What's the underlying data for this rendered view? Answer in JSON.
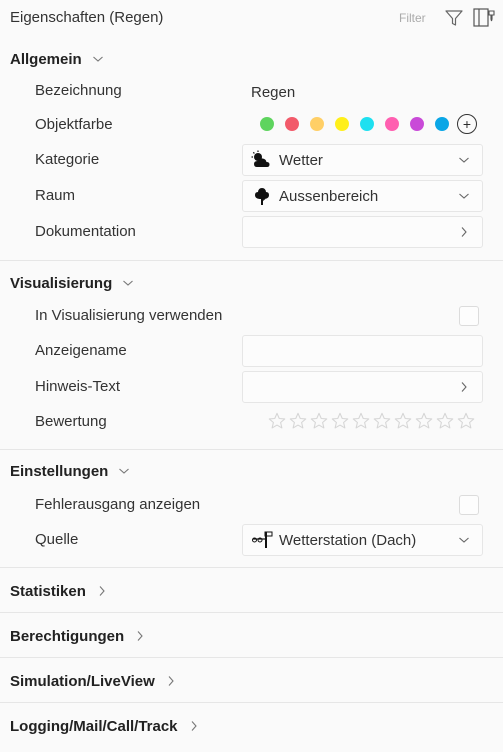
{
  "header": {
    "title": "Eigenschaften (Regen)",
    "filter_label": "Filter"
  },
  "sections": {
    "allgemein": {
      "title": "Allgemein",
      "rows": {
        "bezeichnung": {
          "label": "Bezeichnung",
          "value": "Regen"
        },
        "objektfarbe": {
          "label": "Objektfarbe"
        },
        "kategorie": {
          "label": "Kategorie",
          "value": "Wetter"
        },
        "raum": {
          "label": "Raum",
          "value": "Aussenbereich"
        },
        "dokumentation": {
          "label": "Dokumentation",
          "value": ""
        }
      }
    },
    "visualisierung": {
      "title": "Visualisierung",
      "rows": {
        "verwenden": {
          "label": "In Visualisierung verwenden",
          "checked": false
        },
        "anzeigename": {
          "label": "Anzeigename",
          "value": ""
        },
        "hinweis": {
          "label": "Hinweis-Text",
          "value": ""
        },
        "bewertung": {
          "label": "Bewertung",
          "stars_total": 10,
          "stars_filled": 0
        }
      }
    },
    "einstellungen": {
      "title": "Einstellungen",
      "rows": {
        "fehlerausgang": {
          "label": "Fehlerausgang anzeigen",
          "checked": false
        },
        "quelle": {
          "label": "Quelle",
          "value": "Wetterstation (Dach)"
        }
      }
    },
    "statistiken": {
      "title": "Statistiken"
    },
    "berechtigungen": {
      "title": "Berechtigungen"
    },
    "simulation": {
      "title": "Simulation/LiveView"
    },
    "logging": {
      "title": "Logging/Mail/Call/Track"
    }
  },
  "colors": {
    "swatches": [
      "#5ed45e",
      "#f25a6a",
      "#ffcf66",
      "#ffef1a",
      "#1ee0f0",
      "#ff5fb0",
      "#c94ad8",
      "#0aa6e6"
    ],
    "divider": "#e6e6e6",
    "star_outline": "#d6d6d6"
  },
  "icons": {
    "filter": "filter-icon",
    "pin": "pin-panel-icon",
    "kategorie": "weather-cloud-sun-icon",
    "raum": "tree-icon",
    "quelle": "weather-station-icon"
  }
}
